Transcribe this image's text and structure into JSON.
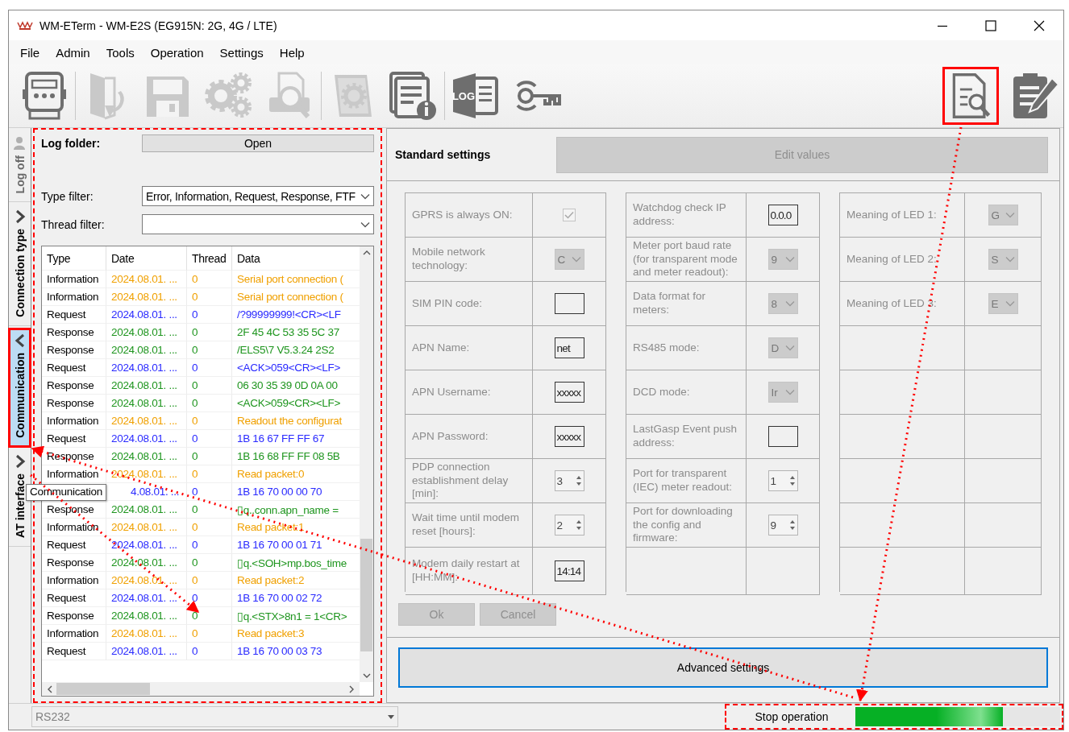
{
  "window": {
    "title": "WM-ETerm - WM-E2S (EG915N: 2G, 4G / LTE)"
  },
  "menu": [
    "File",
    "Admin",
    "Tools",
    "Operation",
    "Settings",
    "Help"
  ],
  "toolbar": {
    "groups": [
      [
        {
          "kind": "meter",
          "disabled": false,
          "highlighted": false
        }
      ],
      [
        {
          "kind": "folder",
          "disabled": true,
          "highlighted": false
        },
        {
          "kind": "floppy",
          "disabled": true,
          "highlighted": false
        },
        {
          "kind": "gears",
          "disabled": true,
          "highlighted": false
        },
        {
          "kind": "printer",
          "disabled": true,
          "highlighted": false
        }
      ],
      [
        {
          "kind": "book",
          "disabled": true,
          "highlighted": false
        },
        {
          "kind": "docinfo",
          "disabled": false,
          "highlighted": false
        }
      ],
      [
        {
          "kind": "log",
          "label": "LOG",
          "disabled": false,
          "highlighted": false
        },
        {
          "kind": "key",
          "disabled": false,
          "highlighted": false
        }
      ]
    ],
    "right": [
      {
        "kind": "docsearch",
        "disabled": false,
        "highlighted": true
      },
      {
        "kind": "docedit",
        "disabled": false,
        "highlighted": false
      }
    ]
  },
  "side_tabs": [
    {
      "label": "Log off",
      "kind": "user",
      "selected": false,
      "highlighted": false
    },
    {
      "label": "Connection type",
      "kind": "chevron",
      "selected": false,
      "highlighted": false
    },
    {
      "label": "Communication",
      "kind": "chevron",
      "selected": true,
      "highlighted": true
    },
    {
      "label": "AT interface",
      "kind": "chevron",
      "selected": false,
      "highlighted": false
    }
  ],
  "tooltip": "Communication",
  "log_panel": {
    "highlighted": true,
    "log_folder_label": "Log folder:",
    "open_button": "Open",
    "type_filter_label": "Type filter:",
    "type_filter_value": "Error, Information, Request, Response, FTF",
    "thread_filter_label": "Thread filter:",
    "columns": [
      "Type",
      "Date",
      "Thread",
      "Data"
    ],
    "rows": [
      {
        "kind": "information",
        "type": "Information",
        "date": "2024.08.01. ...",
        "thread": "0",
        "data": "Serial port connection ("
      },
      {
        "kind": "information",
        "type": "Information",
        "date": "2024.08.01. ...",
        "thread": "0",
        "data": "Serial port connection ("
      },
      {
        "kind": "request",
        "type": "Request",
        "date": "2024.08.01. ...",
        "thread": "0",
        "data": "/?99999999!<CR><LF"
      },
      {
        "kind": "response",
        "type": "Response",
        "date": "2024.08.01. ...",
        "thread": "0",
        "data": "2F 45 4C 53 35 5C 37"
      },
      {
        "kind": "response",
        "type": "Response",
        "date": "2024.08.01. ...",
        "thread": "0",
        "data": "/ELS5\\7 V5.3.24 2S2"
      },
      {
        "kind": "request",
        "type": "Request",
        "date": "2024.08.01. ...",
        "thread": "0",
        "data": "<ACK>059<CR><LF>"
      },
      {
        "kind": "response",
        "type": "Response",
        "date": "2024.08.01. ...",
        "thread": "0",
        "data": "06 30 35 39 0D 0A 00"
      },
      {
        "kind": "response",
        "type": "Response",
        "date": "2024.08.01. ...",
        "thread": "0",
        "data": "<ACK>059<CR><LF>"
      },
      {
        "kind": "information",
        "type": "Information",
        "date": "2024.08.01. ...",
        "thread": "0",
        "data": "Readout the configurat"
      },
      {
        "kind": "request",
        "type": "Request",
        "date": "2024.08.01. ...",
        "thread": "0",
        "data": "1B 16 67 FF FF 67"
      },
      {
        "kind": "response",
        "type": "Response",
        "date": "2024.08.01. ...",
        "thread": "0",
        "data": "1B 16 68 FF FF 08 5B"
      },
      {
        "kind": "information",
        "type": "Information",
        "date": "2024.08.01. ...",
        "thread": "0",
        "data": "Read packet:0"
      },
      {
        "kind": "request",
        "date": "4.08.01. ...",
        "thread": "0",
        "data": "1B 16 70 00 00 70"
      },
      {
        "kind": "response",
        "type": "Response",
        "date": "2024.08.01. ...",
        "thread": "0",
        "data": "▯q..conn.apn_name ="
      },
      {
        "kind": "information",
        "type": "Information",
        "date": "2024.08.01. ...",
        "thread": "0",
        "data": "Read packet:1"
      },
      {
        "kind": "request",
        "type": "Request",
        "date": "2024.08.01. ...",
        "thread": "0",
        "data": "1B 16 70 00 01 71"
      },
      {
        "kind": "response",
        "type": "Response",
        "date": "2024.08.01. ...",
        "thread": "0",
        "data": "▯q.<SOH>mp.bos_time"
      },
      {
        "kind": "information",
        "type": "Information",
        "date": "2024.08.01. ...",
        "thread": "0",
        "data": "Read packet:2"
      },
      {
        "kind": "request",
        "type": "Request",
        "date": "2024.08.01. ...",
        "thread": "0",
        "data": "1B 16 70 00 02 72"
      },
      {
        "kind": "response",
        "type": "Response",
        "date": "2024.08.01. ...",
        "thread": "0",
        "data": "▯q.<STX>8n1 = 1<CR>"
      },
      {
        "kind": "information",
        "type": "Information",
        "date": "2024.08.01. ...",
        "thread": "0",
        "data": "Read packet:3"
      },
      {
        "kind": "request",
        "type": "Request",
        "date": "2024.08.01. ...",
        "thread": "0",
        "data": "1B 16 70 00 03 73"
      }
    ]
  },
  "settings": {
    "title": "Standard settings",
    "edit_button": "Edit values",
    "groups": [
      [
        {
          "label": "GPRS is always ON:",
          "control": {
            "kind": "checkbox",
            "checked": true
          }
        },
        {
          "label": "Mobile network technology:",
          "control": {
            "kind": "combo",
            "value": "C"
          }
        },
        {
          "label": "SIM PIN code:",
          "control": {
            "kind": "text"
          }
        },
        {
          "label": "APN Name:",
          "control": {
            "kind": "text",
            "value": "net"
          }
        },
        {
          "label": "APN Username:",
          "control": {
            "kind": "text",
            "value": "xxxxx"
          }
        },
        {
          "label": "APN Password:",
          "control": {
            "kind": "text",
            "value": "xxxxx"
          }
        },
        {
          "label": "PDP connection establishment delay [min]:",
          "control": {
            "kind": "spin",
            "value": "3"
          }
        },
        {
          "label": "Wait time until modem reset [hours]:",
          "control": {
            "kind": "spin",
            "value": "2"
          }
        },
        {
          "label": "Modem daily restart at [HH:MM]:",
          "control": {
            "kind": "text",
            "value": "14:14"
          }
        }
      ],
      [
        {
          "label": "Watchdog check IP address:",
          "control": {
            "kind": "text",
            "value": "0.0.0"
          }
        },
        {
          "label": "Meter port baud rate (for transparent mode and meter readout):",
          "control": {
            "kind": "combo",
            "value": "9"
          }
        },
        {
          "label": "Data format for meters:",
          "control": {
            "kind": "combo",
            "value": "8"
          }
        },
        {
          "label": "RS485 mode:",
          "control": {
            "kind": "combo",
            "value": "D"
          }
        },
        {
          "label": "DCD mode:",
          "control": {
            "kind": "combo",
            "value": "Ir"
          }
        },
        {
          "label": "LastGasp Event push address:",
          "control": {
            "kind": "text"
          }
        },
        {
          "label": "Port for transparent (IEC) meter readout:",
          "control": {
            "kind": "spin",
            "value": "1"
          }
        },
        {
          "label": "Port for downloading the config and firmware:",
          "control": {
            "kind": "spin",
            "value": "9"
          }
        }
      ],
      [
        {
          "label": "Meaning of LED 1:",
          "control": {
            "kind": "combo",
            "value": "G"
          }
        },
        {
          "label": "Meaning of LED 2:",
          "control": {
            "kind": "combo",
            "value": "S"
          }
        },
        {
          "label": "Meaning of LED 3:",
          "control": {
            "kind": "combo",
            "value": "E"
          }
        }
      ]
    ],
    "ok_button": "Ok",
    "cancel_button": "Cancel",
    "advanced_button": "Advanced settings"
  },
  "status_bar": {
    "port": "RS232",
    "highlighted": true,
    "stop_label": "Stop operation",
    "level": 0.72
  }
}
